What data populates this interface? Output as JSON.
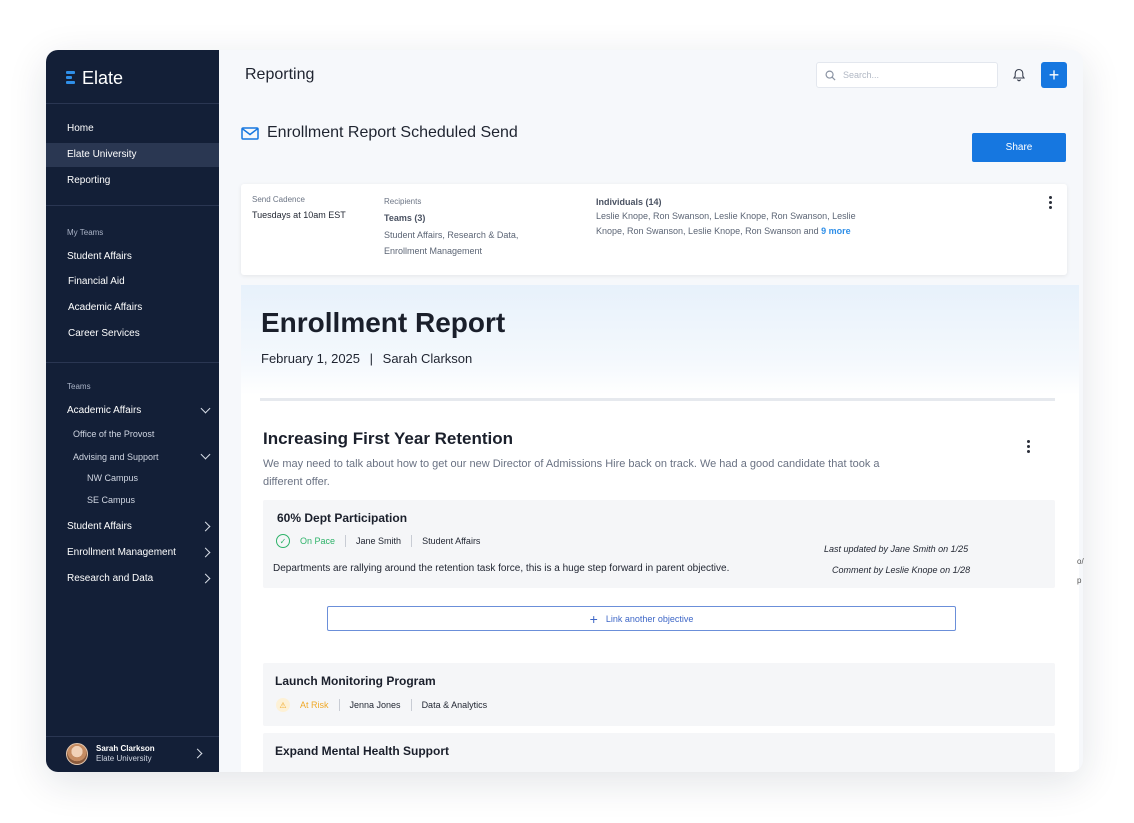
{
  "app": {
    "brand": "Elate"
  },
  "sidebar": {
    "nav": [
      {
        "label": "Home"
      },
      {
        "label": "Elate University",
        "active": true
      },
      {
        "label": "Reporting"
      }
    ],
    "my_teams_heading": "My Teams",
    "my_teams": [
      "Student Affairs",
      "Financial Aid",
      "Academic Affairs",
      "Career Services"
    ],
    "teams_heading": "Teams",
    "teams": [
      {
        "label": "Academic Affairs",
        "chevron": "down"
      },
      {
        "label": "Office of the Provost"
      },
      {
        "label": "Advising and Support",
        "chevron": "down"
      },
      {
        "label": "NW Campus"
      },
      {
        "label": "SE Campus"
      },
      {
        "label": "Student Affairs",
        "chevron": "right"
      },
      {
        "label": "Enrollment Management",
        "chevron": "right"
      },
      {
        "label": "Research and Data",
        "chevron": "right"
      }
    ],
    "profile": {
      "name": "Sarah Clarkson",
      "org": "Elate University"
    }
  },
  "header": {
    "title": "Reporting",
    "search_placeholder": "Search...",
    "add_label": "+"
  },
  "schedule": {
    "title": "Enrollment Report Scheduled Send",
    "share_label": "Share",
    "cadence_label": "Send Cadence",
    "cadence_value": "Tuesdays at 10am EST",
    "recipients_label": "Recipients",
    "teams_label": "Teams (3)",
    "teams_value_1": "Student Affairs, Research & Data,",
    "teams_value_2": "Enrollment Management",
    "individuals_label": "Individuals (14)",
    "individuals_line1": "Leslie Knope, Ron Swanson, Leslie Knope, Ron Swanson, Leslie",
    "individuals_line2": "Knope, Ron Swanson, Leslie Knope, Ron Swanson and",
    "more_link": "9 more"
  },
  "report": {
    "title": "Enrollment Report",
    "date": "February 1, 2025",
    "separator": "|",
    "author": "Sarah Clarkson",
    "section": {
      "title": "Increasing First Year Retention",
      "description": "We may need to talk about how to get our new Director of Admissions Hire back on track. We had a good candidate that took a different offer."
    },
    "objectives": [
      {
        "title": "60% Dept Participation",
        "status": "On Pace",
        "owner": "Jane Smith",
        "team": "Student Affairs",
        "comment": "Departments are rallying around the retention task force, this is a huge step forward in parent objective.",
        "last_updated": "Last updated by Jane Smith on 1/25",
        "comment_by": "Comment by Leslie Knope on 1/28"
      },
      {
        "title": "Launch Monitoring Program",
        "status": "At Risk",
        "owner": "Jenna Jones",
        "team": "Data & Analytics"
      },
      {
        "title": "Expand Mental Health Support"
      }
    ],
    "link_label": "Link another objective"
  },
  "colors": {
    "sidebar_bg": "#131f37",
    "accent": "#1677e0",
    "on_pace": "#2fb36a",
    "at_risk": "#f0a928",
    "link": "#3e67c7"
  },
  "edge_fragments": [
    "o/",
    "p"
  ]
}
